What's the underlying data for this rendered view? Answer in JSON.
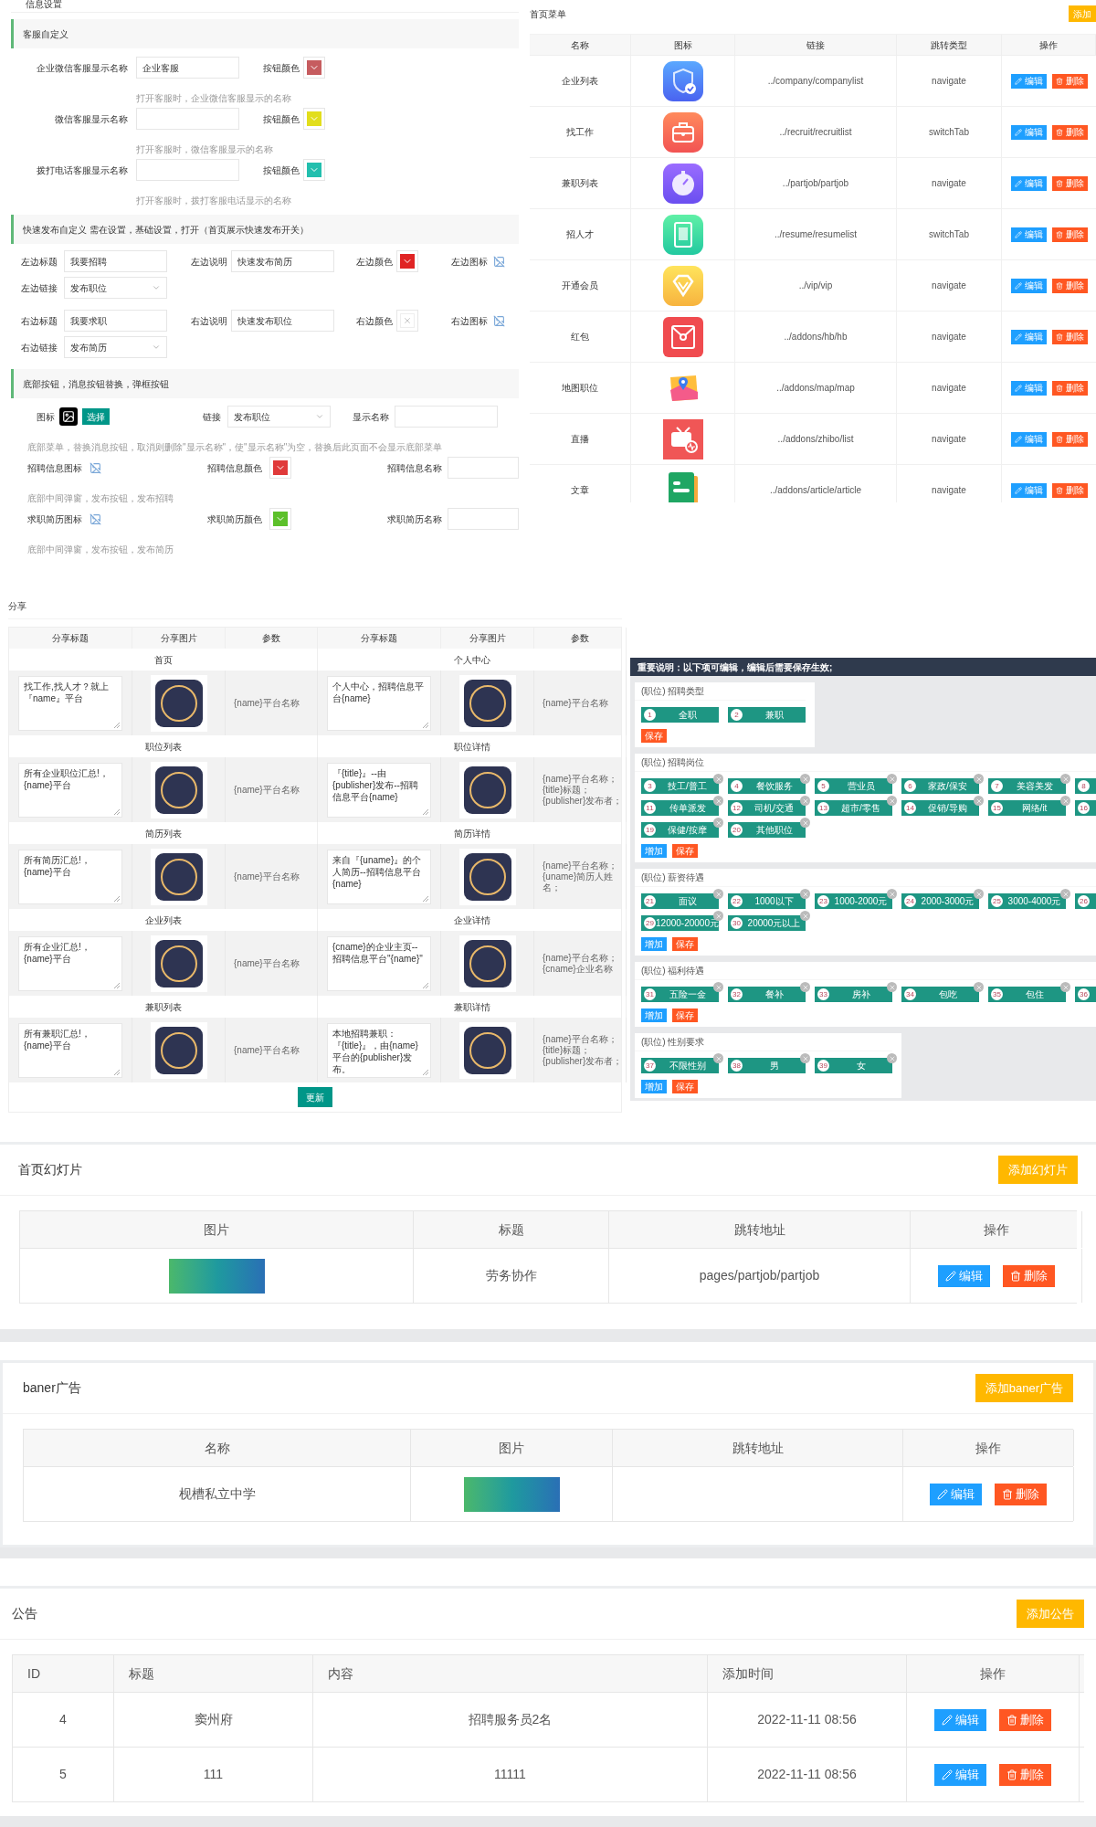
{
  "info_settings": {
    "title": "信息设置",
    "customer_service": {
      "heading": "客服自定义",
      "rows": [
        {
          "label": "企业微信客服显示名称",
          "value": "企业客服",
          "color_label": "按钮颜色",
          "color": "#c65c5f",
          "hint": "打开客服时，企业微信客服显示的名称"
        },
        {
          "label": "微信客服显示名称",
          "color_label": "按钮颜色",
          "color": "#e2de1c",
          "hint": "打开客服时，微信客服显示的名称"
        },
        {
          "label": "拨打电话客服显示名称",
          "color_label": "按钮颜色",
          "color": "#22bfae",
          "hint": "打开客服时，拨打客服电话显示的名称"
        }
      ]
    },
    "quick_publish": {
      "heading": "快速发布自定义 需在设置，基础设置，打开（首页展示快速发布开关）",
      "sides": [
        {
          "title_label": "左边标题",
          "title_value": "我要招聘",
          "desc_label": "左边说明",
          "desc_value": "快速发布简历",
          "color_label": "左边颜色",
          "color": "#e02424",
          "icon_label": "左边图标",
          "link_label": "左边链接",
          "link_value": "发布职位"
        },
        {
          "title_label": "右边标题",
          "title_value": "我要求职",
          "desc_label": "右边说明",
          "desc_value": "快速发布职位",
          "color_label": "右边颜色",
          "icon_label": "右边图标",
          "link_label": "右边链接",
          "link_value": "发布简历"
        }
      ]
    },
    "bottom_buttons": {
      "heading": "底部按钮，消息按钮替换，弹框按钮",
      "icon_label": "图标",
      "choose_button": "选择",
      "link_label": "链接",
      "link_value": "发布职位",
      "name_label": "显示名称",
      "hint": "底部菜单，替换消息按钮，取消则删除\"显示名称\"，使\"显示名称\"为空，替换后此页面不会显示底部菜单",
      "popups": [
        {
          "icon_label": "招聘信息图标",
          "color_label": "招聘信息颜色",
          "color": "#e03a3a",
          "name_label": "招聘信息名称",
          "hint": "底部中间弹窗，发布按钮，发布招聘"
        },
        {
          "icon_label": "求职简历图标",
          "color_label": "求职简历颜色",
          "color": "#5cc02a",
          "name_label": "求职简历名称",
          "hint": "底部中间弹窗，发布按钮，发布简历"
        }
      ]
    }
  },
  "home_menu": {
    "title": "首页菜单",
    "add_button": "添加",
    "columns": [
      "名称",
      "图标",
      "链接",
      "跳转类型",
      "操作"
    ],
    "rows": [
      {
        "name": "企业列表",
        "link": "../company/companylist",
        "type": "navigate",
        "actions": [
          {
            "kind": "edit",
            "label": "编辑"
          },
          {
            "kind": "delete",
            "label": "删除"
          }
        ]
      },
      {
        "name": "找工作",
        "link": "../recruit/recruitlist",
        "type": "switchTab",
        "actions": [
          {
            "kind": "edit",
            "label": "编辑"
          },
          {
            "kind": "delete",
            "label": "删除"
          }
        ]
      },
      {
        "name": "兼职列表",
        "link": "../partjob/partjob",
        "type": "navigate",
        "actions": [
          {
            "kind": "edit",
            "label": "编辑"
          },
          {
            "kind": "delete",
            "label": "删除"
          }
        ]
      },
      {
        "name": "招人才",
        "link": "../resume/resumelist",
        "type": "switchTab",
        "actions": [
          {
            "kind": "edit",
            "label": "编辑"
          },
          {
            "kind": "delete",
            "label": "删除"
          }
        ]
      },
      {
        "name": "开通会员",
        "link": "../vip/vip",
        "type": "navigate",
        "actions": [
          {
            "kind": "edit",
            "label": "编辑"
          },
          {
            "kind": "delete",
            "label": "删除"
          }
        ]
      },
      {
        "name": "红包",
        "link": "../addons/hb/hb",
        "type": "navigate",
        "actions": [
          {
            "kind": "edit",
            "label": "编辑"
          },
          {
            "kind": "delete",
            "label": "删除"
          }
        ]
      },
      {
        "name": "地图职位",
        "link": "../addons/map/map",
        "type": "navigate",
        "actions": [
          {
            "kind": "edit",
            "label": "编辑"
          },
          {
            "kind": "delete",
            "label": "删除"
          }
        ]
      },
      {
        "name": "直播",
        "link": "../addons/zhibo/list",
        "type": "navigate",
        "actions": [
          {
            "kind": "edit",
            "label": "编辑"
          },
          {
            "kind": "delete",
            "label": "删除"
          }
        ]
      },
      {
        "name": "文章",
        "link": "../addons/article/article",
        "type": "navigate",
        "actions": [
          {
            "kind": "edit",
            "label": "编辑"
          },
          {
            "kind": "delete",
            "label": "删除"
          }
        ]
      }
    ]
  },
  "share": {
    "title": "分享",
    "columns": [
      "分享标题",
      "分享图片",
      "参数",
      "分享标题",
      "分享图片",
      "参数"
    ],
    "groups": [
      {
        "pages": [
          {
            "page": "首页",
            "share_title": "找工作,找人才？就上『name』平台",
            "params": [
              "{name}平台名称"
            ]
          },
          {
            "page": "个人中心",
            "share_title": "个人中心，招聘信息平台{name}",
            "params": [
              "{name}平台名称"
            ]
          }
        ]
      },
      {
        "pages": [
          {
            "page": "职位列表",
            "share_title": "所有企业职位汇总!，{name}平台",
            "params": [
              "{name}平台名称"
            ]
          },
          {
            "page": "职位详情",
            "share_title": "『{title}』--由{publisher}发布--招聘信息平台{name}",
            "params": [
              "{name}平台名称；",
              "{title}标题；",
              "{publisher}发布者；"
            ]
          }
        ]
      },
      {
        "pages": [
          {
            "page": "简历列表",
            "share_title": "所有简历汇总!，{name}平台",
            "params": [
              "{name}平台名称"
            ]
          },
          {
            "page": "简历详情",
            "share_title": "来自『{uname}』的个人简历--招聘信息平台{name}",
            "params": [
              "{name}平台名称；",
              "{uname}简历人姓名；"
            ]
          }
        ]
      },
      {
        "pages": [
          {
            "page": "企业列表",
            "share_title": "所有企业汇总!，{name}平台",
            "params": [
              "{name}平台名称"
            ]
          },
          {
            "page": "企业详情",
            "share_title": "{cname}的企业主页--招聘信息平台\"{name}\"",
            "params": [
              "{name}平台名称；",
              "{cname}企业名称"
            ]
          }
        ]
      },
      {
        "pages": [
          {
            "page": "兼职列表",
            "share_title": "所有兼职汇总!，{name}平台",
            "params": [
              "{name}平台名称"
            ]
          },
          {
            "page": "兼职详情",
            "share_title": "本地招聘兼职：『{title}』，由{name}平台的{publisher}发布。",
            "params": [
              "{name}平台名称；",
              "{title}标题；",
              "{publisher}发布者；"
            ]
          }
        ]
      }
    ],
    "update_button": "更新"
  },
  "tag_settings": {
    "notice": "重要说明：以下项可编辑，编辑后需要保存生效;",
    "groups": [
      {
        "title": "(职位) 招聘类型",
        "rows": [
          [
            {
              "num": "1",
              "label": "全职",
              "removable": false
            },
            {
              "num": "2",
              "label": "兼职",
              "removable": false
            }
          ]
        ],
        "buttons": [
          {
            "kind": "save",
            "label": "保存"
          }
        ]
      },
      {
        "title": "(职位) 招聘岗位",
        "rows": [
          [
            {
              "num": "3",
              "label": "技工/普工",
              "removable": true
            },
            {
              "num": "4",
              "label": "餐饮服务",
              "removable": true
            },
            {
              "num": "5",
              "label": "营业员",
              "removable": true
            },
            {
              "num": "6",
              "label": "家政/保安",
              "removable": true
            },
            {
              "num": "7",
              "label": "美容美发",
              "removable": true
            },
            {
              "num": "8"
            }
          ],
          [
            {
              "num": "11",
              "label": "传单派发",
              "removable": true
            },
            {
              "num": "12",
              "label": "司机/交通",
              "removable": true
            },
            {
              "num": "13",
              "label": "超市/零售",
              "removable": true
            },
            {
              "num": "14",
              "label": "促销/导购",
              "removable": true
            },
            {
              "num": "15",
              "label": "网络/it",
              "removable": true
            },
            {
              "num": "16"
            }
          ],
          [
            {
              "num": "19",
              "label": "保健/按摩",
              "removable": true
            },
            {
              "num": "20",
              "label": "其他职位",
              "removable": true
            }
          ]
        ],
        "buttons": [
          {
            "kind": "add",
            "label": "增加"
          },
          {
            "kind": "save",
            "label": "保存"
          }
        ]
      },
      {
        "title": "(职位) 薪资待遇",
        "rows": [
          [
            {
              "num": "21",
              "label": "面议",
              "removable": true
            },
            {
              "num": "22",
              "label": "1000以下",
              "removable": true
            },
            {
              "num": "23",
              "label": "1000-2000元",
              "removable": true
            },
            {
              "num": "24",
              "label": "2000-3000元",
              "removable": true
            },
            {
              "num": "25",
              "label": "3000-4000元",
              "removable": true
            },
            {
              "num": "26"
            }
          ],
          [
            {
              "num": "29",
              "label": "12000-20000元",
              "removable": true
            },
            {
              "num": "30",
              "label": "20000元以上",
              "removable": true
            }
          ]
        ],
        "buttons": [
          {
            "kind": "add",
            "label": "增加"
          },
          {
            "kind": "save",
            "label": "保存"
          }
        ]
      },
      {
        "title": "(职位) 福利待遇",
        "rows": [
          [
            {
              "num": "31",
              "label": "五险一金",
              "removable": true
            },
            {
              "num": "32",
              "label": "餐补",
              "removable": true
            },
            {
              "num": "33",
              "label": "房补",
              "removable": true
            },
            {
              "num": "34",
              "label": "包吃",
              "removable": true
            },
            {
              "num": "35",
              "label": "包住",
              "removable": true
            },
            {
              "num": "36"
            }
          ]
        ],
        "buttons": [
          {
            "kind": "add",
            "label": "增加"
          },
          {
            "kind": "save",
            "label": "保存"
          }
        ]
      },
      {
        "title": "(职位) 性别要求",
        "rows": [
          [
            {
              "num": "37",
              "label": "不限性别",
              "removable": true
            },
            {
              "num": "38",
              "label": "男",
              "removable": true
            },
            {
              "num": "39",
              "label": "女",
              "removable": true
            }
          ]
        ],
        "buttons": [
          {
            "kind": "add",
            "label": "增加"
          },
          {
            "kind": "save",
            "label": "保存"
          }
        ]
      }
    ]
  },
  "slides": {
    "title": "首页幻灯片",
    "add_button": "添加幻灯片",
    "columns": [
      "图片",
      "标题",
      "跳转地址",
      "操作"
    ],
    "rows": [
      {
        "title": "劳务协作",
        "link": "pages/partjob/partjob",
        "actions": [
          {
            "kind": "edit",
            "label": "编辑"
          },
          {
            "kind": "delete",
            "label": "删除"
          }
        ]
      }
    ]
  },
  "banner_ads": {
    "title": "baner广告",
    "add_button": "添加baner广告",
    "columns": [
      "名称",
      "图片",
      "跳转地址",
      "操作"
    ],
    "rows": [
      {
        "name": "枧槽私立中学",
        "actions": [
          {
            "kind": "edit",
            "label": "编辑"
          },
          {
            "kind": "delete",
            "label": "删除"
          }
        ]
      }
    ]
  },
  "notices": {
    "title": "公告",
    "add_button": "添加公告",
    "columns": [
      "ID",
      "标题",
      "内容",
      "添加时间",
      "操作"
    ],
    "rows": [
      {
        "id": "4",
        "title": "窦州府",
        "content": "招聘服务员2名",
        "time": "2022-11-11 08:56",
        "actions": [
          {
            "kind": "edit",
            "label": "编辑"
          },
          {
            "kind": "delete",
            "label": "删除"
          }
        ]
      },
      {
        "id": "5",
        "title": "111",
        "content": "11111",
        "time": "2022-11-11 08:56",
        "actions": [
          {
            "kind": "edit",
            "label": "编辑"
          },
          {
            "kind": "delete",
            "label": "删除"
          }
        ]
      }
    ]
  }
}
